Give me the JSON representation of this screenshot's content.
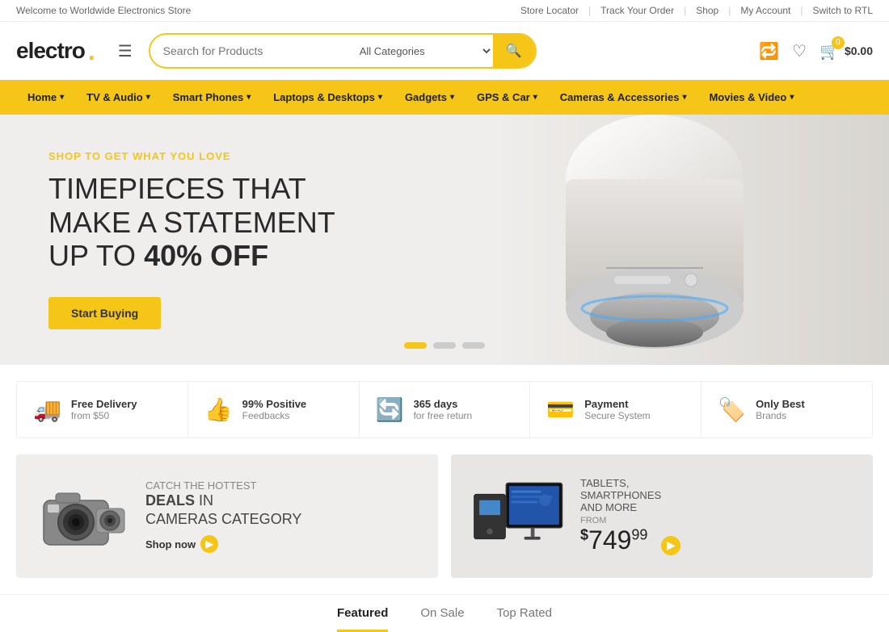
{
  "topbar": {
    "welcome": "Welcome to Worldwide Electronics Store",
    "store_locator": "Store Locator",
    "track_order": "Track Your Order",
    "shop": "Shop",
    "my_account": "My Account",
    "switch_rtl": "Switch to RTL"
  },
  "header": {
    "logo_text": "electro",
    "logo_dot": ".",
    "search_placeholder": "Search for Products",
    "category_label": "All Categories",
    "cart_badge": "0",
    "cart_price": "$0.00"
  },
  "nav": {
    "items": [
      {
        "label": "Home",
        "has_dropdown": true
      },
      {
        "label": "TV & Audio",
        "has_dropdown": true
      },
      {
        "label": "Smart Phones",
        "has_dropdown": true
      },
      {
        "label": "Laptops & Desktops",
        "has_dropdown": true
      },
      {
        "label": "Gadgets",
        "has_dropdown": true
      },
      {
        "label": "GPS & Car",
        "has_dropdown": true
      },
      {
        "label": "Cameras & Accessories",
        "has_dropdown": true
      },
      {
        "label": "Movies & Video",
        "has_dropdown": true
      }
    ]
  },
  "hero": {
    "sub_title": "SHOP TO GET WHAT YOU LOVE",
    "line1": "TIMEPIECES THAT",
    "line2": "MAKE A STATEMENT",
    "line3_prefix": "UP TO ",
    "line3_bold": "40% OFF",
    "cta": "Start Buying",
    "dots": [
      true,
      false,
      false
    ]
  },
  "features": [
    {
      "icon": "🚚",
      "title": "Free Delivery",
      "sub": "from $50"
    },
    {
      "icon": "👍",
      "title": "99% Positive",
      "sub": "Feedbacks"
    },
    {
      "icon": "🔄",
      "title": "365 days",
      "sub": "for free return"
    },
    {
      "icon": "💳",
      "title": "Payment",
      "sub": "Secure System"
    },
    {
      "icon": "🏷️",
      "title": "Only Best",
      "sub": "Brands"
    }
  ],
  "promo": {
    "left": {
      "label": "CATCH THE HOTTEST",
      "title_bold": "DEALS",
      "title_suffix": " IN\nCAMERAS CATEGORY",
      "shop_now": "Shop now"
    },
    "right": {
      "label": "TABLETS,\nSMARTPHONES\nAND MORE",
      "from": "FROM",
      "price_symbol": "$",
      "price_main": "749",
      "price_cents": "99"
    }
  },
  "tabs": [
    {
      "label": "Featured",
      "active": true
    },
    {
      "label": "On Sale",
      "active": false
    },
    {
      "label": "Top Rated",
      "active": false
    }
  ]
}
